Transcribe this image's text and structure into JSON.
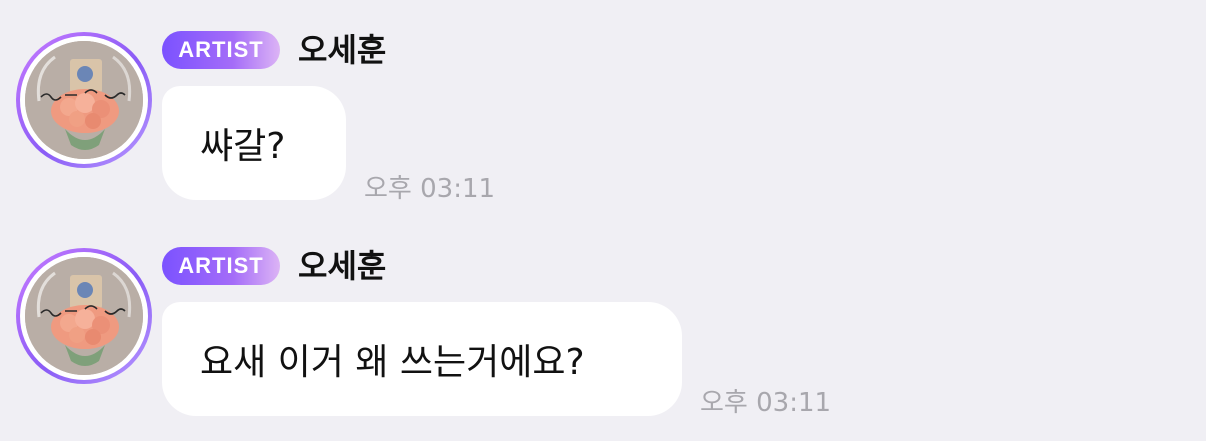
{
  "messages": [
    {
      "badge": "ARTIST",
      "name": "오세훈",
      "text": "쌰갈?",
      "time": "오후 03:11"
    },
    {
      "badge": "ARTIST",
      "name": "오세훈",
      "text": "요새 이거 왜 쓰는거에요?",
      "time": "오후 03:11"
    }
  ],
  "avatar_icon": "profile-photo-flower-bouquet"
}
